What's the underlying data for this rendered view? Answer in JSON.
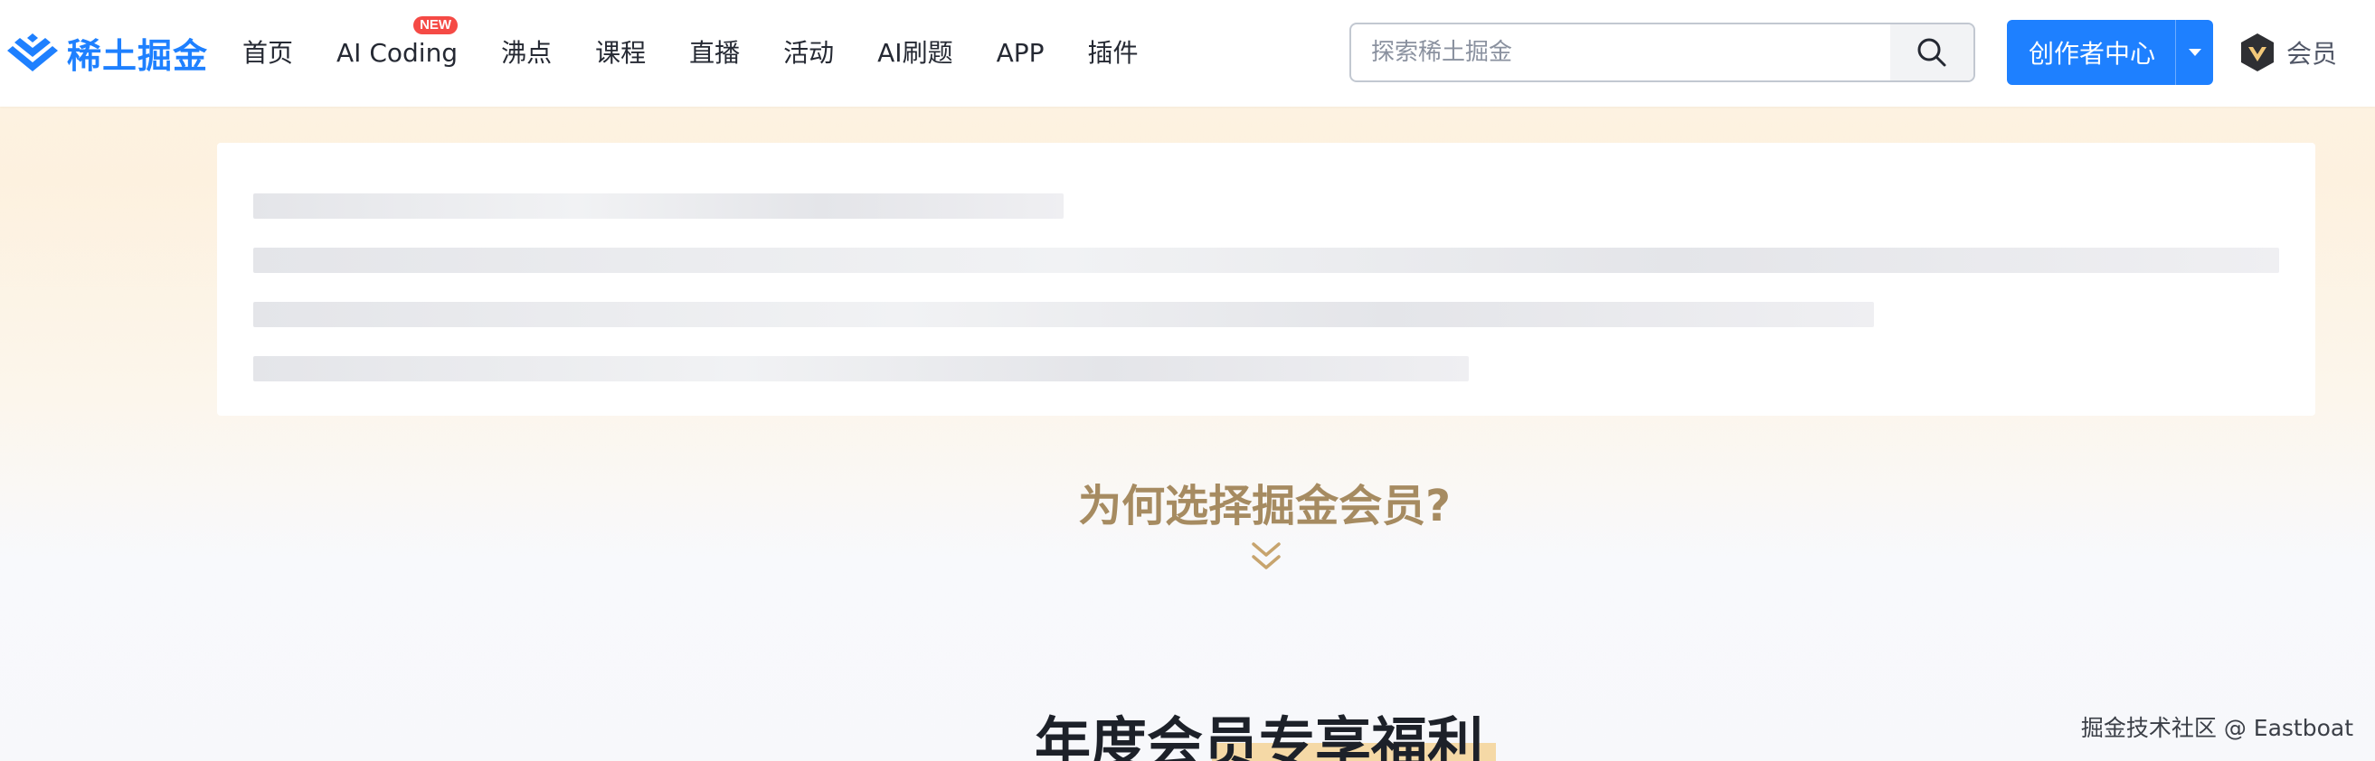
{
  "header": {
    "logo_text": "稀土掘金",
    "nav": [
      {
        "label": "首页"
      },
      {
        "label": "AI Coding",
        "badge": "NEW"
      },
      {
        "label": "沸点"
      },
      {
        "label": "课程"
      },
      {
        "label": "直播"
      },
      {
        "label": "活动"
      },
      {
        "label": "AI刷题"
      },
      {
        "label": "APP"
      },
      {
        "label": "插件"
      }
    ],
    "search": {
      "placeholder": "探索稀土掘金",
      "icon": "search-icon"
    },
    "creator_button": {
      "label": "创作者中心",
      "dropdown_icon": "caret-down-icon"
    },
    "vip": {
      "label": "会员",
      "icon": "vip-badge-icon"
    }
  },
  "main": {
    "section_title": "为何选择掘金会员?",
    "section_icon": "double-chevron-down-icon",
    "annual_title": "年度会员专享福利"
  },
  "watermark": "掘金技术社区 @ Eastboat",
  "colors": {
    "brand": "#1e80ff",
    "gold": "#a68b61",
    "skeleton": "#e4e5e9"
  }
}
